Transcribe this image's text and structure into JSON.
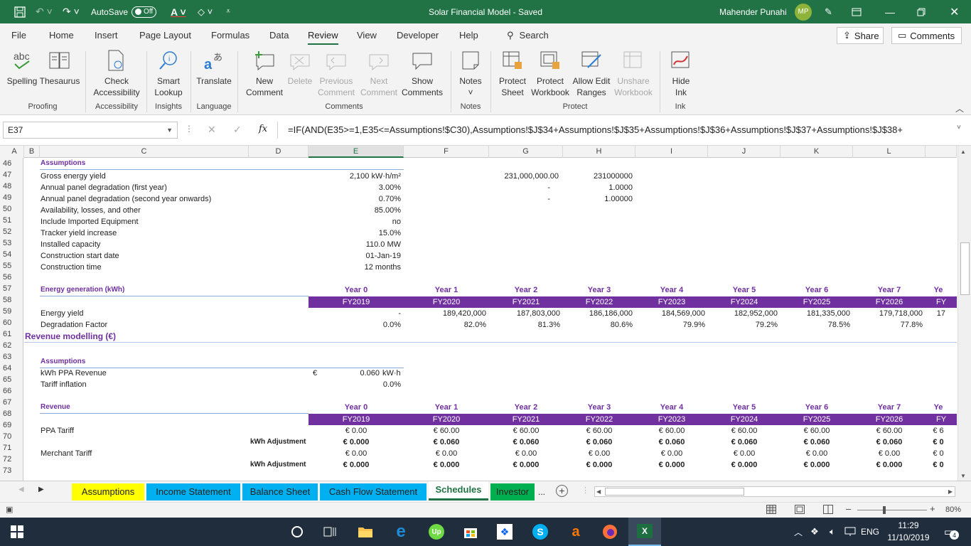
{
  "titlebar": {
    "autosave_label": "AutoSave",
    "autosave_state": "Off",
    "doc_title": "Solar Financial Model  -  Saved",
    "user_name": "Mahender Punahi",
    "user_initials": "MP"
  },
  "tabs": [
    "File",
    "Home",
    "Insert",
    "Page Layout",
    "Formulas",
    "Data",
    "Review",
    "View",
    "Developer",
    "Help"
  ],
  "active_tab": "Review",
  "search_label": "Search",
  "share_label": "Share",
  "comments_label": "Comments",
  "ribbon": {
    "spelling": "Spelling",
    "thesaurus": "Thesaurus",
    "check_acc_1": "Check",
    "check_acc_2": "Accessibility",
    "smart_1": "Smart",
    "smart_2": "Lookup",
    "translate": "Translate",
    "new_comment_1": "New",
    "new_comment_2": "Comment",
    "delete": "Delete",
    "previous_1": "Previous",
    "previous_2": "Comment",
    "next_1": "Next",
    "next_2": "Comment",
    "show_1": "Show",
    "show_2": "Comments",
    "notes": "Notes",
    "protect_sheet_1": "Protect",
    "protect_sheet_2": "Sheet",
    "protect_wb_1": "Protect",
    "protect_wb_2": "Workbook",
    "allow_edit_1": "Allow Edit",
    "allow_edit_2": "Ranges",
    "unshare_1": "Unshare",
    "unshare_2": "Workbook",
    "hide_ink_1": "Hide",
    "hide_ink_2": "Ink",
    "groups": {
      "proofing": "Proofing",
      "accessibility": "Accessibility",
      "insights": "Insights",
      "language": "Language",
      "comments": "Comments",
      "notes": "Notes",
      "protect": "Protect",
      "ink": "Ink"
    }
  },
  "formula_bar": {
    "name_box": "E37",
    "fx": "fx",
    "formula": "=IF(AND(E35>=1,E35<=Assumptions!$C30),Assumptions!$J$34+Assumptions!$J$35+Assumptions!$J$36+Assumptions!$J$37+Assumptions!$J$38+"
  },
  "columns": [
    "A",
    "B",
    "C",
    "D",
    "E",
    "F",
    "G",
    "H",
    "I",
    "J",
    "K",
    "L"
  ],
  "selected_column": "E",
  "rows": [
    "46",
    "47",
    "48",
    "49",
    "50",
    "51",
    "52",
    "53",
    "54",
    "55",
    "56",
    "57",
    "58",
    "59",
    "60",
    "61",
    "62",
    "63",
    "64",
    "65",
    "66",
    "67",
    "68",
    "69",
    "70",
    "71",
    "72",
    "73"
  ],
  "sheet": {
    "assumptions_header": "Assumptions",
    "gross_energy_label": "Gross energy yield",
    "gross_energy_value": "2,100 kW·h/m²",
    "degr_first_label": "Annual panel degradation (first year)",
    "degr_first_value": "3.00%",
    "degr_second_label": "Annual panel degradation (second year onwards)",
    "degr_second_value": "0.70%",
    "avail_label": "Availability, losses, and other",
    "avail_value": "85.00%",
    "imported_label": "Include Imported Equipment",
    "imported_value": "no",
    "tracker_label": "Tracker yield increase",
    "tracker_value": "15.0%",
    "capacity_label": "Installed capacity",
    "capacity_value": "110.0 MW",
    "start_label": "Construction start date",
    "start_value": "01-Jan-19",
    "time_label": "Construction time",
    "time_value": "12 months",
    "g47": "231,000,000.00",
    "h47": "231000000",
    "g48": "-",
    "h48": "1.0000",
    "g49": "-",
    "h49": "1.00000",
    "energy_gen_header": "Energy generation (kWh)",
    "years": [
      "Year 0",
      "Year 1",
      "Year 2",
      "Year 3",
      "Year 4",
      "Year 5",
      "Year 6",
      "Year 7",
      "Ye"
    ],
    "fys": [
      "FY2019",
      "FY2020",
      "FY2021",
      "FY2022",
      "FY2023",
      "FY2024",
      "FY2025",
      "FY2026",
      "FY"
    ],
    "energy_yield_label": "Energy yield",
    "energy_yield": [
      "-",
      "189,420,000",
      "187,803,000",
      "186,186,000",
      "184,569,000",
      "182,952,000",
      "181,335,000",
      "179,718,000",
      "17"
    ],
    "degr_factor_label": "Degradation Factor",
    "degr_factor": [
      "0.0%",
      "82.0%",
      "81.3%",
      "80.6%",
      "79.9%",
      "79.2%",
      "78.5%",
      "77.8%",
      ""
    ],
    "revenue_modelling": "Revenue modelling (€)",
    "assumptions_header2": "Assumptions",
    "ppa_rev_label": "kWh PPA Revenue",
    "ppa_rev_currency": "€",
    "ppa_rev_value": "0.060",
    "ppa_rev_unit": "kW·h",
    "tariff_infl_label": "Tariff inflation",
    "tariff_infl_value": "0.0%",
    "revenue_header": "Revenue",
    "ppa_tariff_label": "PPA Tariff",
    "kwh_adj_label": "kWh Adjustment",
    "ppa_tariff": [
      "€ 0.00",
      "€ 60.00",
      "€ 60.00",
      "€ 60.00",
      "€ 60.00",
      "€ 60.00",
      "€ 60.00",
      "€ 60.00",
      "€ 6"
    ],
    "ppa_adj": [
      "€ 0.000",
      "€ 0.060",
      "€ 0.060",
      "€ 0.060",
      "€ 0.060",
      "€ 0.060",
      "€ 0.060",
      "€ 0.060",
      "€ 0"
    ],
    "merchant_label": "Merchant Tariff",
    "kwh_adj_label2": "kWh Adjustment",
    "merchant": [
      "€ 0.00",
      "€ 0.00",
      "€ 0.00",
      "€ 0.00",
      "€ 0.00",
      "€ 0.00",
      "€ 0.00",
      "€ 0.00",
      "€ 0"
    ],
    "merchant_adj": [
      "€ 0.000",
      "€ 0.000",
      "€ 0.000",
      "€ 0.000",
      "€ 0.000",
      "€ 0.000",
      "€ 0.000",
      "€ 0.000",
      "€ 0"
    ]
  },
  "sheet_tabs": [
    {
      "label": "Assumptions",
      "color": "#ffff00"
    },
    {
      "label": "Income Statement",
      "color": "#00b0f0"
    },
    {
      "label": "Balance Sheet",
      "color": "#00b0f0"
    },
    {
      "label": "Cash Flow Statement",
      "color": "#00b0f0"
    },
    {
      "label": "Schedules",
      "color": "#ffffff"
    },
    {
      "label": "Investor",
      "color": "#00b050"
    }
  ],
  "more_tabs": "...",
  "zoom_minus": "–",
  "zoom_plus": "+",
  "zoom": "80%",
  "taskbar": {
    "lang": "ENG",
    "time": "11:29",
    "date": "11/10/2019",
    "notif_count": "4"
  },
  "colors": {
    "excel_green": "#217346",
    "purple": "#7030a0",
    "header_line": "#8eaadb"
  }
}
